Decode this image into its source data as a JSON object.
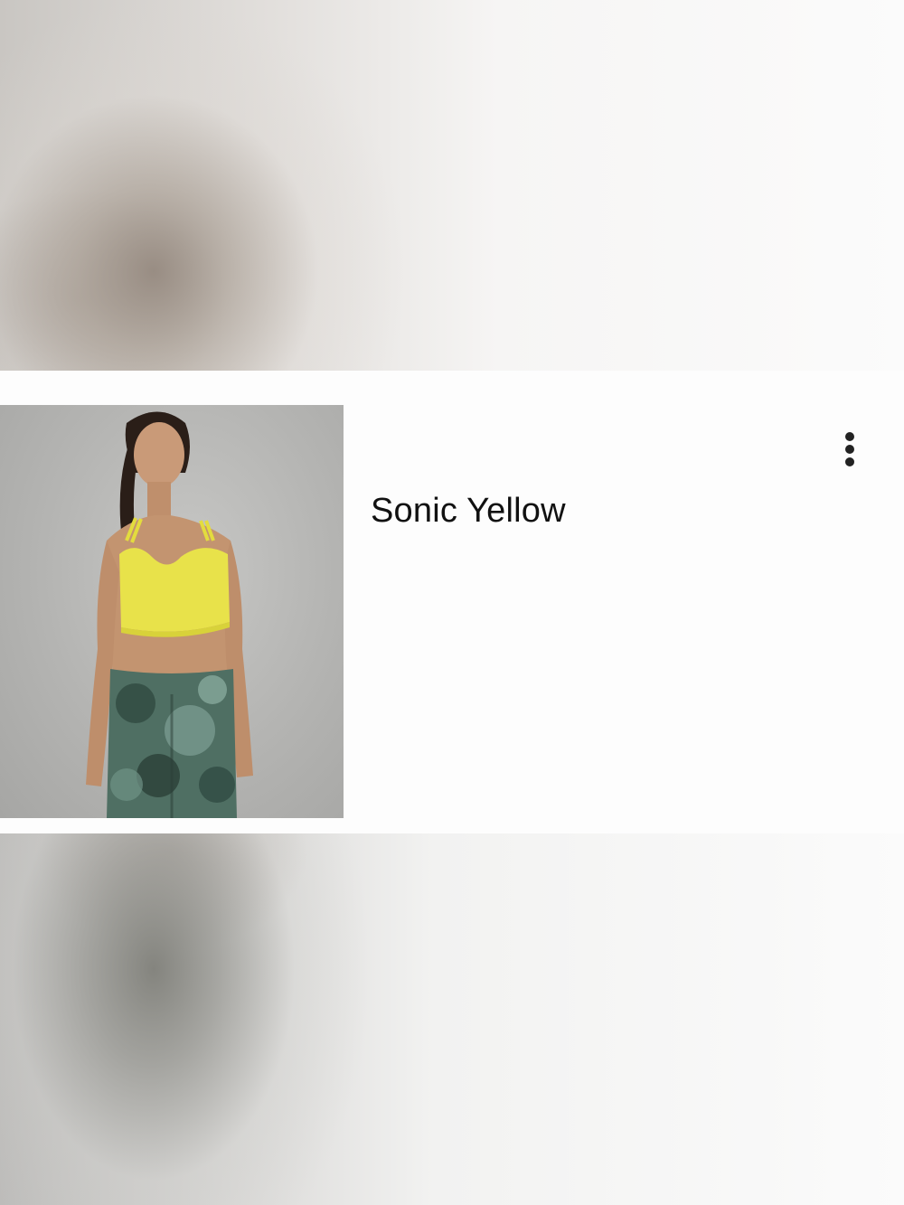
{
  "card": {
    "title": "Sonic Yellow",
    "more_icon": "more-vertical-icon"
  },
  "colors": {
    "text": "#111111",
    "bra": "#e8e24a",
    "leggings": "#4f6f63"
  }
}
